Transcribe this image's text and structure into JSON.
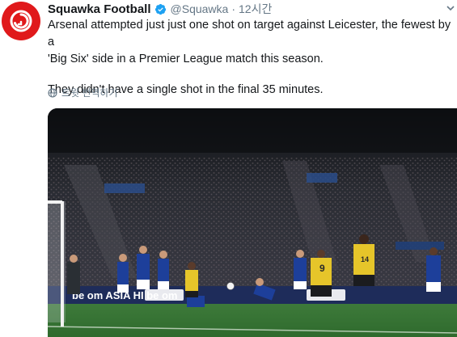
{
  "account": {
    "display_name": "Squawka Football",
    "handle": "@Squawka",
    "separator": "·",
    "time": "12시간",
    "avatar_icon": "squawka-logo",
    "verified_icon": "verified-badge-icon",
    "brand_color": "#e0191b"
  },
  "tweet": {
    "line1": "Arsenal attempted just just one shot on target against Leicester, the fewest by a",
    "line2": "'Big Six' side in a Premier League match this season.",
    "line3": "They didn't have a single shot in the final 35 minutes."
  },
  "translate": {
    "icon": "globe-icon",
    "label": "트윗 번역하기"
  },
  "media": {
    "alt_icon": "football-match-photo",
    "jersey_numbers": [
      "9",
      "14"
    ],
    "ad_board_text": "be   om  ASIA HI   be   om"
  },
  "colors": {
    "text": "#14171a",
    "secondary": "#657786",
    "verified": "#1da1f2"
  }
}
